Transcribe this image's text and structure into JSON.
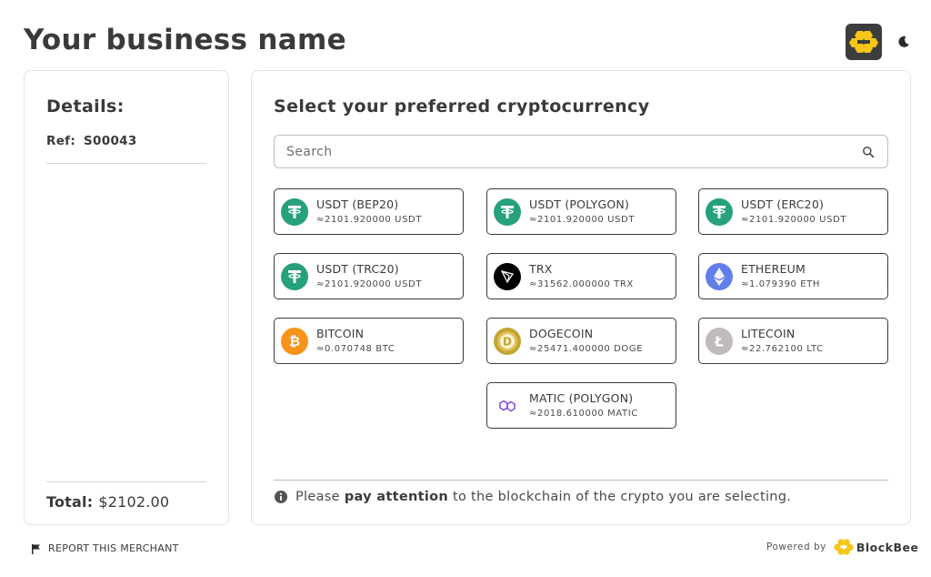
{
  "header": {
    "business_name": "Your business name",
    "logo_icon": "blockbee-logo-icon",
    "theme_icon": "moon-icon"
  },
  "details": {
    "title": "Details:",
    "ref_label": "Ref:",
    "ref_value": "S00043",
    "total_label": "Total:",
    "total_value": "$2102.00"
  },
  "main": {
    "title": "Select your preferred cryptocurrency",
    "search_placeholder": "Search",
    "coins": [
      {
        "name": "USDT (BEP20)",
        "amount": "≈2101.920000 USDT",
        "icon": "tether-icon",
        "color": "#26a17b"
      },
      {
        "name": "USDT (POLYGON)",
        "amount": "≈2101.920000 USDT",
        "icon": "tether-icon",
        "color": "#26a17b"
      },
      {
        "name": "USDT (ERC20)",
        "amount": "≈2101.920000 USDT",
        "icon": "tether-icon",
        "color": "#26a17b"
      },
      {
        "name": "USDT (TRC20)",
        "amount": "≈2101.920000 USDT",
        "icon": "tether-icon",
        "color": "#26a17b"
      },
      {
        "name": "TRX",
        "amount": "≈31562.000000 TRX",
        "icon": "tron-icon",
        "color": "#000000"
      },
      {
        "name": "ETHEREUM",
        "amount": "≈1.079390 ETH",
        "icon": "ethereum-icon",
        "color": "#627eea"
      },
      {
        "name": "BITCOIN",
        "amount": "≈0.070748 BTC",
        "icon": "bitcoin-icon",
        "color": "#f7931a"
      },
      {
        "name": "DOGECOIN",
        "amount": "≈25471.400000 DOGE",
        "icon": "dogecoin-icon",
        "color": "#c2a633"
      },
      {
        "name": "LITECOIN",
        "amount": "≈22.762100 LTC",
        "icon": "litecoin-icon",
        "color": "#bfbbbb"
      },
      {
        "name": "MATIC (POLYGON)",
        "amount": "≈2018.610000 MATIC",
        "icon": "polygon-icon",
        "color": "#8247e5"
      }
    ],
    "note_prefix": "Please",
    "note_emphasis": "pay attention",
    "note_suffix": "to the blockchain of the crypto you are selecting."
  },
  "footer": {
    "report_label": "REPORT THIS MERCHANT",
    "powered_label": "Powered by",
    "brand_name": "BlockBee"
  },
  "colors": {
    "text": "#3a3a3a",
    "border": "#e2e2e2",
    "brand_yellow": "#f6c619"
  }
}
